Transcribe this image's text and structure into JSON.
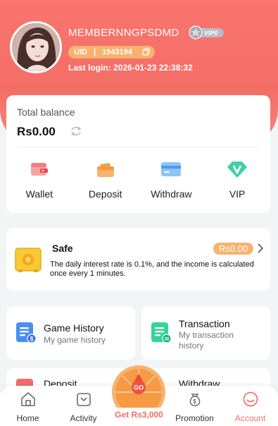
{
  "header": {
    "username": "MEMBERNNGPSDMD",
    "vip_badge": "VIP0",
    "uid_label": "UID",
    "uid_value": "1943194",
    "last_login": "Last login: 2026-01-23 22:38:32"
  },
  "balance": {
    "label": "Total balance",
    "amount": "Rs0.00",
    "actions": [
      {
        "label": "Wallet",
        "icon": "wallet-icon"
      },
      {
        "label": "Deposit",
        "icon": "deposit-icon"
      },
      {
        "label": "Withdraw",
        "icon": "withdraw-icon"
      },
      {
        "label": "VIP",
        "icon": "vip-icon"
      }
    ]
  },
  "safe": {
    "title": "Safe",
    "amount": "Rs0.00",
    "description": "The daily interest rate is 0.1%, and the income is calculated once every 1 minutes."
  },
  "menu": {
    "game_history": {
      "title": "Game History",
      "subtitle": "My game history"
    },
    "transaction": {
      "title": "Transaction",
      "subtitle": "My transaction history"
    },
    "deposit": {
      "title": "Deposit"
    },
    "withdraw": {
      "title": "Withdraw"
    }
  },
  "navbar": {
    "items": [
      {
        "label": "Home",
        "icon": "home-icon"
      },
      {
        "label": "Activity",
        "icon": "activity-icon"
      },
      {
        "label": "Get Rs3,000",
        "icon": "lucky-wheel-icon"
      },
      {
        "label": "Promotion",
        "icon": "promotion-icon"
      },
      {
        "label": "Account",
        "icon": "account-icon"
      }
    ],
    "active": "Account",
    "wheel_text": "GO"
  },
  "colors": {
    "brand": "#f36e66",
    "accent_orange": "#f7b36e",
    "background": "#f3f4f6"
  }
}
